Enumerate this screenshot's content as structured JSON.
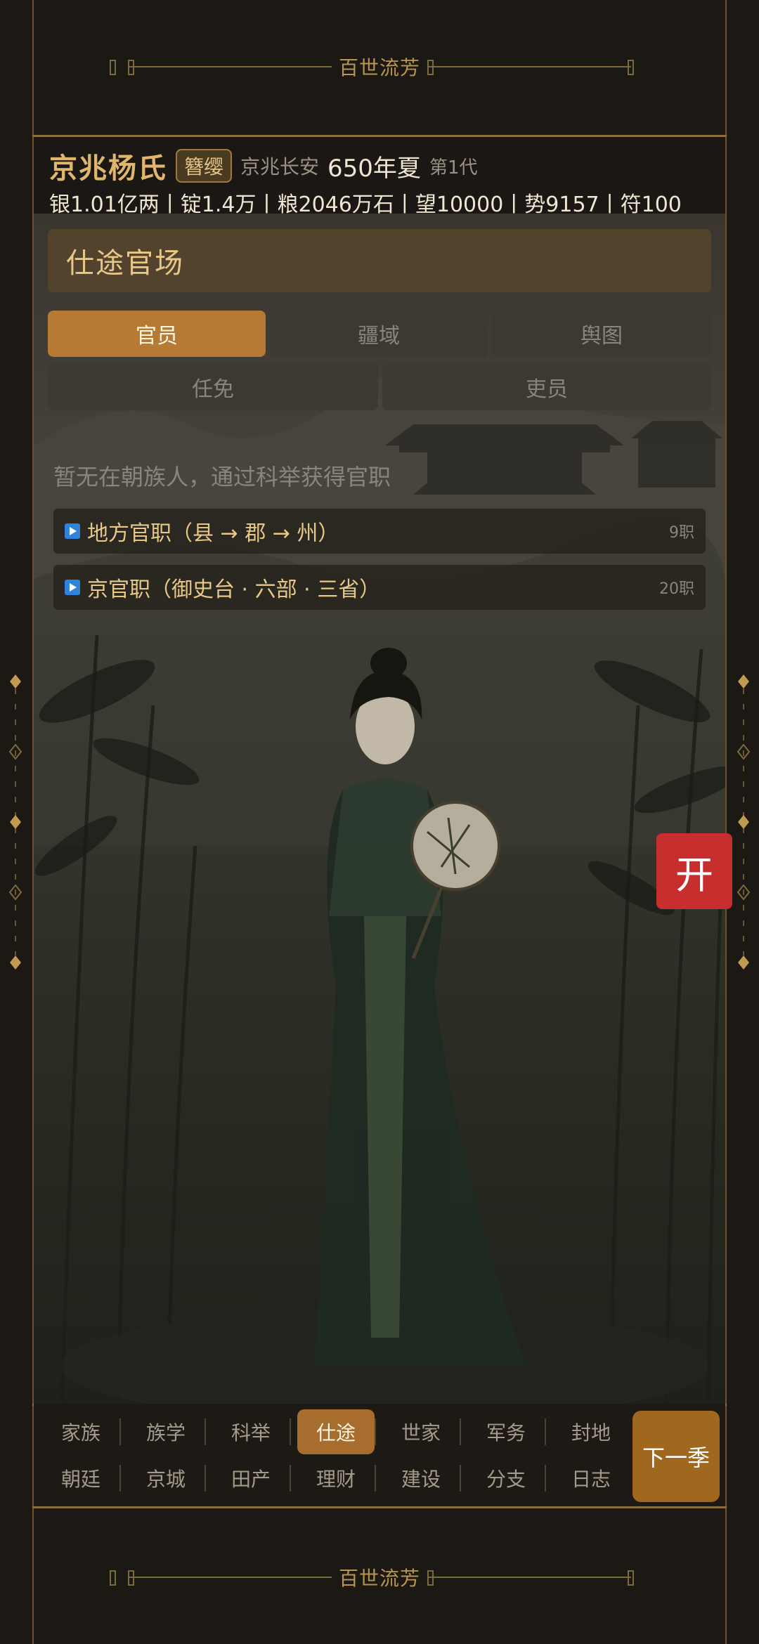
{
  "banner": {
    "title": "百世流芳"
  },
  "header": {
    "clan_name": "京兆杨氏",
    "rank": "簪缨",
    "location": "京兆长安",
    "date": "650年夏",
    "generation": "第1代",
    "resources": "银1.01亿两丨锭1.4万丨粮2046万石丨望10000丨势9157丨符100"
  },
  "panel": {
    "title": "仕途官场",
    "tabs": [
      {
        "label": "官员",
        "active": true
      },
      {
        "label": "疆域",
        "active": false
      },
      {
        "label": "舆图",
        "active": false
      },
      {
        "label": "任免",
        "active": false
      },
      {
        "label": "吏员",
        "active": false
      }
    ],
    "empty_note": "暂无在朝族人，通过科举获得官职",
    "offices": [
      {
        "label": "地方官职（县 → 郡 → 州）",
        "count": "9职"
      },
      {
        "label": "京官职（御史台 · 六部 · 三省）",
        "count": "20职"
      }
    ]
  },
  "open_button": "开",
  "bottom_nav": {
    "row1": [
      "家族",
      "族学",
      "科举",
      "仕途",
      "世家",
      "军务",
      "封地"
    ],
    "row2": [
      "朝廷",
      "京城",
      "田产",
      "理财",
      "建设",
      "分支",
      "日志"
    ],
    "active": "仕途",
    "next_label": "下一季"
  },
  "colors": {
    "background": "#1c1915",
    "accent_gold": "#e0b56c",
    "active_tab": "#b77a34",
    "open_button": "#c72f2f",
    "next_button": "#a0671f"
  }
}
